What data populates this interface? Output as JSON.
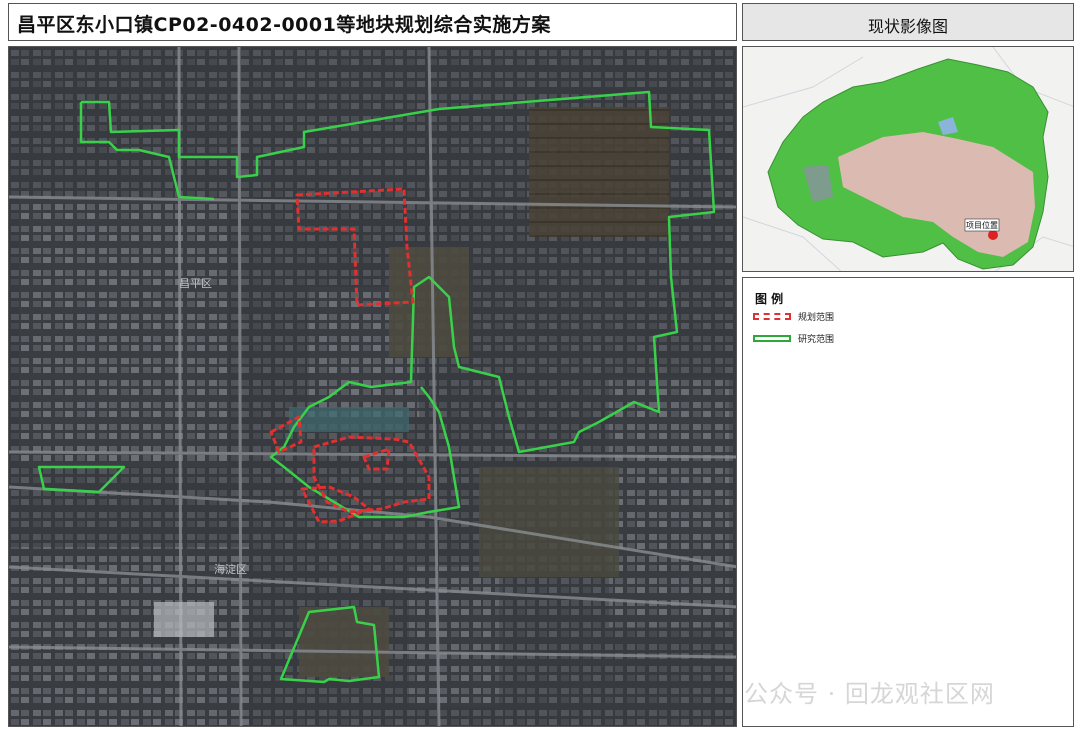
{
  "header": {
    "title": "昌平区东小口镇CP02-0402-0001等地块规划综合实施方案",
    "subtitle": "现状影像图"
  },
  "map_labels": {
    "district_changping": "昌平区",
    "district_haidian": "海淀区"
  },
  "locator_map": {
    "project_location_label": "项目位置"
  },
  "legend": {
    "title": "图 例",
    "items": [
      {
        "label": "规划范围",
        "color": "#e03030",
        "style": "dashed"
      },
      {
        "label": "研究范围",
        "color": "#2fa83a",
        "style": "solid"
      }
    ]
  },
  "watermark": "公众号 · 回龙观社区网",
  "colors": {
    "planning_boundary": "#e03030",
    "study_boundary": "#39d14a",
    "locator_green": "#4fbf45",
    "locator_pink": "#f3b8c4"
  }
}
